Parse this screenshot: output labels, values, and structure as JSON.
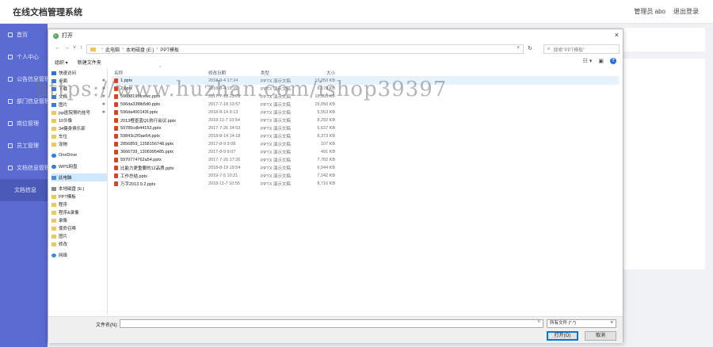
{
  "app": {
    "title": "在线文档管理系统",
    "user": "管理员 abo",
    "logout": "退出登录"
  },
  "sidebar": {
    "items": [
      {
        "label": "首页"
      },
      {
        "label": "个人中心"
      },
      {
        "label": "公告信息管理"
      },
      {
        "label": "部门信息管理"
      },
      {
        "label": "岗位管理"
      },
      {
        "label": "员工管理"
      },
      {
        "label": "文档信息管理"
      },
      {
        "label": "文档信息"
      }
    ]
  },
  "dialog": {
    "title": "打开",
    "close": "×",
    "address": {
      "crumbs": [
        "此电脑",
        "本地磁盘 (E:)",
        "PPT模板"
      ]
    },
    "search_placeholder": "搜索\"PPT模板\"",
    "toolbar": {
      "organize": "组织 ▾",
      "new_folder": "新建文件夹"
    },
    "nav": {
      "items": [
        {
          "label": "快速访问",
          "icon": "star"
        },
        {
          "label": "桌面",
          "icon": "blue",
          "pin": true
        },
        {
          "label": "下载",
          "icon": "blue",
          "pin": true
        },
        {
          "label": "文档",
          "icon": "blue",
          "pin": true
        },
        {
          "label": "图片",
          "icon": "blue",
          "pin": true
        },
        {
          "label": "jsp医院预约挂号",
          "icon": "folder",
          "pin": true
        },
        {
          "label": "10头像",
          "icon": "folder"
        },
        {
          "label": "34健身俱乐部",
          "icon": "folder"
        },
        {
          "label": "车位",
          "icon": "folder"
        },
        {
          "label": "宠物",
          "icon": "folder"
        },
        {
          "label": "",
          "icon": "gap"
        },
        {
          "label": "OneDrive",
          "icon": "cloud"
        },
        {
          "label": "",
          "icon": "gap"
        },
        {
          "label": "WPS网盘",
          "icon": "cloud"
        },
        {
          "label": "",
          "icon": "gap"
        },
        {
          "label": "此电脑",
          "icon": "pc",
          "selected": true
        },
        {
          "label": "",
          "icon": "gap"
        },
        {
          "label": "本地磁盘 (E:)",
          "icon": "disk"
        },
        {
          "label": "PPT模板",
          "icon": "folder"
        },
        {
          "label": "程序",
          "icon": "folder"
        },
        {
          "label": "程序&录像",
          "icon": "folder"
        },
        {
          "label": "录像",
          "icon": "folder"
        },
        {
          "label": "使命召唤",
          "icon": "folder"
        },
        {
          "label": "图片",
          "icon": "folder"
        },
        {
          "label": "修改",
          "icon": "folder"
        },
        {
          "label": "",
          "icon": "gap"
        },
        {
          "label": "网络",
          "icon": "net"
        }
      ]
    },
    "columns": {
      "name": "名称",
      "date": "修改日期",
      "type": "类型",
      "size": "大小"
    },
    "files": [
      {
        "name": "1.pptx",
        "date": "2018-8-4 17:24",
        "type": "PPTX 演示文稿",
        "size": "13,050 KB"
      },
      {
        "name": "2.pptx",
        "date": "2018-8-4 16:26",
        "type": "PPTX 演示文稿",
        "size": "8,178 KB"
      },
      {
        "name": "596d819fdcewc.pptx",
        "date": "2017-7-18 23:09",
        "type": "PPTX 演示文稿",
        "size": "10,895 KB"
      },
      {
        "name": "596da33f8b5d0.pptx",
        "date": "2017-7-18 13:57",
        "type": "PPTX 演示文稿",
        "size": "15,050 KB"
      },
      {
        "name": "596da400143f.pptx",
        "date": "2018-8-14 9:13",
        "type": "PPTX 演示文稿",
        "size": "5,553 KB"
      },
      {
        "name": "2013橙墨蓝Q1执行会议.pptx",
        "date": "2018-11-7 10:54",
        "type": "PPTX 演示文稿",
        "size": "8,292 KB"
      },
      {
        "name": "59785cdb44153.pptx",
        "date": "2017-7-26 14:53",
        "type": "PPTX 演示文稿",
        "size": "5,637 KB"
      },
      {
        "name": "59843c2f0ae64.pptx",
        "date": "2018-8-14 14:18",
        "type": "PPTX 演示文稿",
        "size": "8,373 KB"
      },
      {
        "name": "2856859_1358156748.pptx",
        "date": "2017-8-9 9:08",
        "type": "PPTX 演示文稿",
        "size": "107 KB"
      },
      {
        "name": "3666739_1306995485.pptx",
        "date": "2017-8-9 9:07",
        "type": "PPTX 演示文稿",
        "size": "491 KB"
      },
      {
        "name": "5970774762a54.pptx",
        "date": "2017-7-20 17:26",
        "type": "PPTX 演示文稿",
        "size": "7,782 KB"
      },
      {
        "name": "比能力更重要的12品质.pptx",
        "date": "2018-8-19 19:54",
        "type": "PPTX 演示文稿",
        "size": "6,044 KB"
      },
      {
        "name": "工作总结.pptx",
        "date": "2019-7-5 10:21",
        "type": "PPTX 演示文稿",
        "size": "7,242 KB"
      },
      {
        "name": "万字2013.9.2.pptx",
        "date": "2018-11-7 10:55",
        "type": "PPTX 演示文稿",
        "size": "8,716 KB"
      }
    ],
    "filename_label": "文件名(N):",
    "filetype": "所有文件 (*.*)",
    "open_button": "打开(O)",
    "cancel_button": "取消"
  },
  "watermark": "https://www.huzhan.com/ishop39397"
}
